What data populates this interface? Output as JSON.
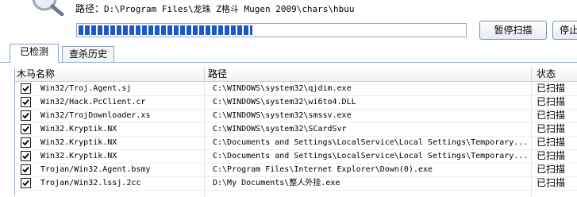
{
  "scan": {
    "path_label": "路径：",
    "path_value": "D:\\Program Files\\龙珠 Z格斗 Mugen 2009\\chars\\hbuu",
    "progress_fraction": 0.45
  },
  "buttons": {
    "pause_label": "暂停扫描",
    "stop_label": "停止"
  },
  "tabs": [
    {
      "label": "已检测",
      "active": true
    },
    {
      "label": "查杀历史",
      "active": false
    }
  ],
  "table": {
    "headers": [
      "木马名称",
      "路径",
      "状态"
    ],
    "rows": [
      {
        "checked": true,
        "name": "Win32/Troj.Agent.sj",
        "path": "C:\\WINDOWS\\system32\\qjdim.exe",
        "status": "已扫描"
      },
      {
        "checked": true,
        "name": "Win32/Hack.PcClient.cr",
        "path": "C:\\WINDOWS\\system32\\wi6to4.DLL",
        "status": "已扫描"
      },
      {
        "checked": true,
        "name": "Win32/TrojDownloader.xs",
        "path": "C:\\WINDOWS\\system32\\smssv.exe",
        "status": "已扫描"
      },
      {
        "checked": true,
        "name": "Win32.Kryptik.NX",
        "path": "C:\\WINDOWS\\system32\\SCardSvr",
        "status": "已扫描"
      },
      {
        "checked": true,
        "name": "Win32.Kryptik.NX",
        "path": "C:\\Documents and Settings\\LocalService\\Local Settings\\Temporary...",
        "status": "已扫描"
      },
      {
        "checked": true,
        "name": "Win32.Kryptik.NX",
        "path": "C:\\Documents and Settings\\LocalService\\Local Settings\\Temporary...",
        "status": "已扫描"
      },
      {
        "checked": true,
        "name": "Trojan/Win32.Agent.bsmy",
        "path": "C:\\Program Files\\Internet Explorer\\Down(0).exe",
        "status": "已扫描"
      },
      {
        "checked": true,
        "name": "Trojan/Win32.lssj.2cc",
        "path": "D:\\My Documents\\整人外挂.exe",
        "status": "已扫描"
      }
    ]
  },
  "icons": {
    "logo": "magnifier-icon",
    "row_check": "checkbox-checked-icon"
  },
  "colors": {
    "progress": "#1c59c6",
    "tab_border": "#8da4c6"
  }
}
